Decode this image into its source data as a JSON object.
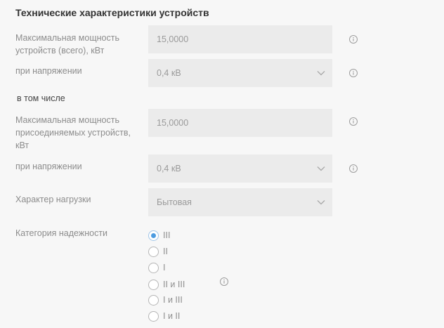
{
  "section_title": "Технические характеристики устройств",
  "fields": {
    "max_power_total": {
      "label": "Максимальная мощность устройств (всего), кВт",
      "value": "15,0000"
    },
    "voltage_total": {
      "label": "при напряжении",
      "value": "0,4 кВ"
    },
    "including_heading": "в том числе",
    "max_power_connected": {
      "label": "Максимальная мощность присоединяемых устройств, кВт",
      "value": "15,0000"
    },
    "voltage_connected": {
      "label": "при напряжении",
      "value": "0,4 кВ"
    },
    "load_type": {
      "label": "Характер нагрузки",
      "value": "Бытовая"
    },
    "reliability": {
      "label": "Категория надежности",
      "selected": "III",
      "options": [
        "III",
        "II",
        "I",
        "II и III",
        "I и III",
        "I и II"
      ]
    }
  },
  "icons": {
    "info": "info-circle-icon",
    "dropdown": "chevron-down-icon"
  },
  "colors": {
    "accent": "#4c9be0",
    "field_bg": "#ebebeb",
    "page_bg": "#f7f7f7"
  }
}
